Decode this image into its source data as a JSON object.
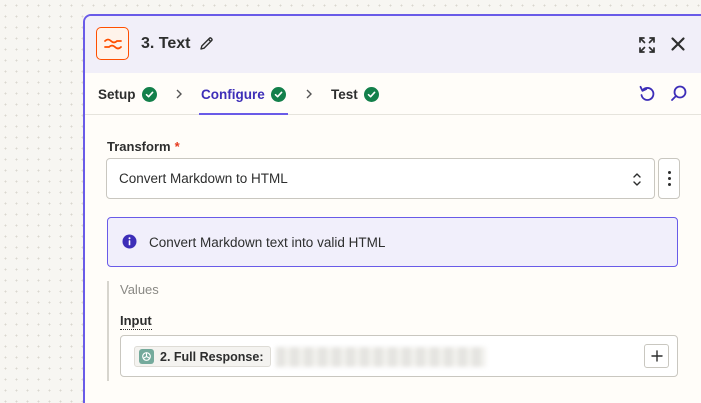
{
  "header": {
    "step_title": "3. Text"
  },
  "tabs": [
    {
      "label": "Setup",
      "status": "complete"
    },
    {
      "label": "Configure",
      "status": "complete",
      "active": true
    },
    {
      "label": "Test",
      "status": "complete"
    }
  ],
  "transform": {
    "label": "Transform",
    "required_mark": "*",
    "selected_value": "Convert Markdown to HTML"
  },
  "info": {
    "text": "Convert Markdown text into valid HTML"
  },
  "values": {
    "section_title": "Values",
    "input_label": "Input",
    "mapped_field_label": "2. Full Response:"
  },
  "icons": {
    "app": "text-formatter-icon",
    "edit": "pencil-icon",
    "expand": "expand-icon",
    "close": "close-icon",
    "undo": "undo-icon",
    "search": "search-icon",
    "step_status": "check-circle-icon",
    "info": "info-icon",
    "more": "kebab-icon",
    "add": "plus-icon",
    "mapped_source": "chatgpt-icon"
  },
  "colors": {
    "accent": "#695be8",
    "active_tab": "#3d2eb8",
    "success": "#13804b",
    "app_brand": "#ff4f00",
    "required": "#e5391d"
  }
}
